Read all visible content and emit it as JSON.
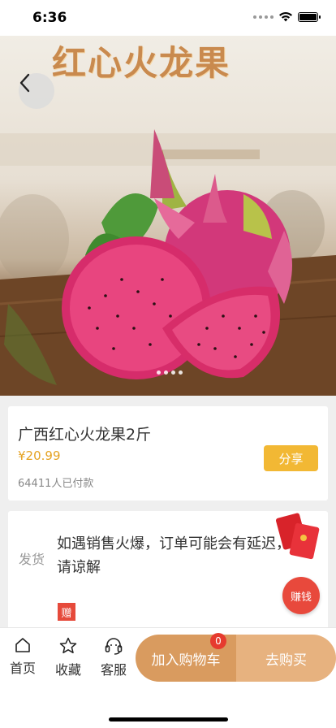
{
  "status_bar": {
    "time": "6:36"
  },
  "hero": {
    "title": "红心火龙果",
    "page_count": 4,
    "active_page": 1
  },
  "product": {
    "name": "广西红心火龙果2斤",
    "price": "¥20.99",
    "sold": "64411人已付款",
    "share_label": "分享"
  },
  "shipping": {
    "label": "发货",
    "text": "如遇销售火爆，订单可能会有延迟，请谅解",
    "gift_badge": "赠"
  },
  "floating": {
    "earn_label": "赚钱"
  },
  "bottom_bar": {
    "home_label": "首页",
    "favorite_label": "收藏",
    "service_label": "客服",
    "cart_label": "加入购物车",
    "cart_count": "0",
    "buy_label": "去购买"
  },
  "colors": {
    "accent": "#f2b834",
    "price": "#e5a323",
    "cart": "#d99b5f",
    "buy": "#e7b27f",
    "badge": "#e63b2e"
  }
}
